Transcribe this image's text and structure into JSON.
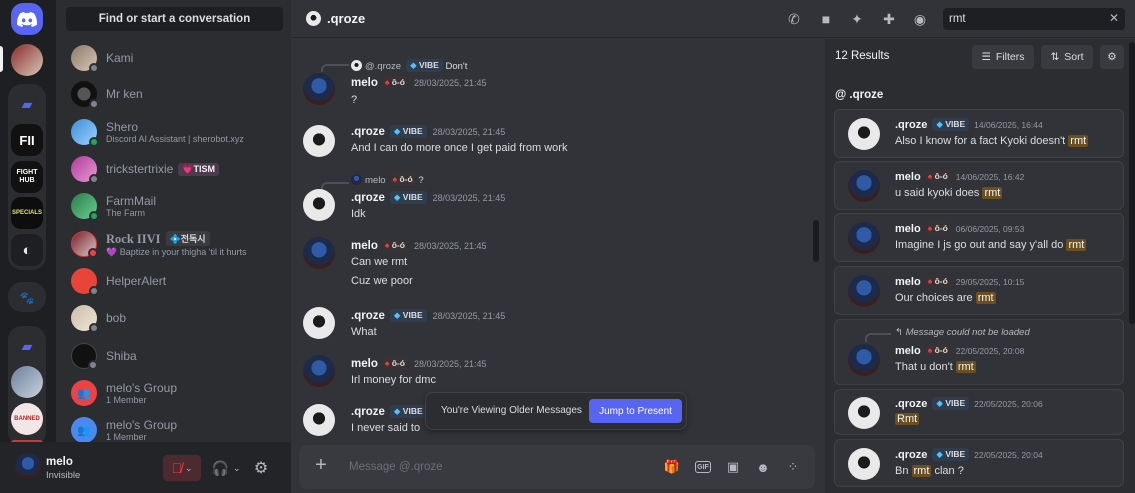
{
  "dm_sidebar": {
    "search_label": "Find or start a conversation",
    "items": [
      {
        "name": "Kami",
        "sub": "",
        "tag": "",
        "status": "#80848e"
      },
      {
        "name": "Mr ken",
        "sub": "",
        "tag": "",
        "status": "#80848e"
      },
      {
        "name": "Shero",
        "sub": "Discord AI Assistant | sherobot.xyz",
        "tag": "",
        "status": "#23a55a"
      },
      {
        "name": "trickstertrixie",
        "sub": "",
        "tag": "💗TISM",
        "status": "#80848e"
      },
      {
        "name": "FarmMail",
        "sub": "The Farm",
        "tag": "",
        "status": "#23a55a"
      },
      {
        "name": "Rock IIVI",
        "sub": "💜 Baptize in your thigha 'til it hurts",
        "tag": "💠전독시",
        "status": "#f23f43"
      },
      {
        "name": "HelperAlert",
        "sub": "",
        "tag": "",
        "status": "#80848e"
      },
      {
        "name": "bob",
        "sub": "",
        "tag": "",
        "status": "#80848e"
      },
      {
        "name": "Shiba",
        "sub": "",
        "tag": "",
        "status": "#80848e"
      },
      {
        "name": "melo's Group",
        "sub": "1 Member",
        "tag": "",
        "status": ""
      },
      {
        "name": "melo's Group",
        "sub": "1 Member",
        "tag": "",
        "status": ""
      }
    ]
  },
  "user_panel": {
    "name": "melo",
    "status": "Invisible"
  },
  "header": {
    "title": ".qroze",
    "search_value": "rmt"
  },
  "chat": {
    "reply_top": {
      "author": "@.qroze",
      "badge": "VIBE",
      "text": "Don't"
    },
    "reply_mid": {
      "author": "melo",
      "badge": "ô-ó",
      "text": "?"
    },
    "messages": [
      {
        "author": "melo",
        "badge": "ô-ó",
        "time": "28/03/2025, 21:45",
        "lines": [
          "?"
        ]
      },
      {
        "author": ".qroze",
        "badge": "VIBE",
        "time": "28/03/2025, 21:45",
        "lines": [
          "And I can do more once I get paid from work"
        ]
      },
      {
        "author": ".qroze",
        "badge": "VIBE",
        "time": "28/03/2025, 21:45",
        "lines": [
          "Idk"
        ]
      },
      {
        "author": "melo",
        "badge": "ô-ó",
        "time": "28/03/2025, 21:45",
        "lines": [
          "Can we rmt",
          "Cuz we poor"
        ]
      },
      {
        "author": ".qroze",
        "badge": "VIBE",
        "time": "28/03/2025, 21:45",
        "lines": [
          "What"
        ]
      },
      {
        "author": "melo",
        "badge": "ô-ó",
        "time": "28/03/2025, 21:45",
        "lines": [
          "Irl money for dmc"
        ]
      },
      {
        "author": ".qroze",
        "badge": "VIBE",
        "time": "",
        "lines": [
          "I never said to"
        ]
      }
    ],
    "older_text": "You're Viewing Older Messages",
    "jump_label": "Jump to Present",
    "composer_placeholder": "Message @.qroze"
  },
  "results": {
    "count": "12 Results",
    "filters_label": "Filters",
    "sort_label": "Sort",
    "channel": "@ .qroze",
    "reply_note": "Message could not be loaded",
    "items": [
      {
        "author": ".qroze",
        "badge": "VIBE",
        "time": "14/06/2025, 16:44",
        "before": "Also I know for a fact Kyoki doesn't ",
        "hit": "rmt",
        "after": ""
      },
      {
        "author": "melo",
        "badge": "ô-ó",
        "time": "14/06/2025, 16:42",
        "before": "u said kyoki does ",
        "hit": "rmt",
        "after": ""
      },
      {
        "author": "melo",
        "badge": "ô-ó",
        "time": "06/06/2025, 09:53",
        "before": "Imagine I js go out and say y'all do ",
        "hit": "rmt",
        "after": ""
      },
      {
        "author": "melo",
        "badge": "ô-ó",
        "time": "29/05/2025, 10:15",
        "before": "Our choices are ",
        "hit": "rmt",
        "after": ""
      },
      {
        "author": "melo",
        "badge": "ô-ó",
        "time": "22/05/2025, 20:08",
        "before": "That u don't ",
        "hit": "rmt",
        "after": ""
      },
      {
        "author": ".qroze",
        "badge": "VIBE",
        "time": "22/05/2025, 20:06",
        "before": "",
        "hit": "Rmt",
        "after": ""
      },
      {
        "author": ".qroze",
        "badge": "VIBE",
        "time": "22/05/2025, 20:04",
        "before": "Bn ",
        "hit": "rmt",
        "after": " clan ?"
      }
    ]
  },
  "colors": {
    "accent": "#5865f2",
    "highlight": "#6b4f1f",
    "danger": "#f23f42"
  }
}
